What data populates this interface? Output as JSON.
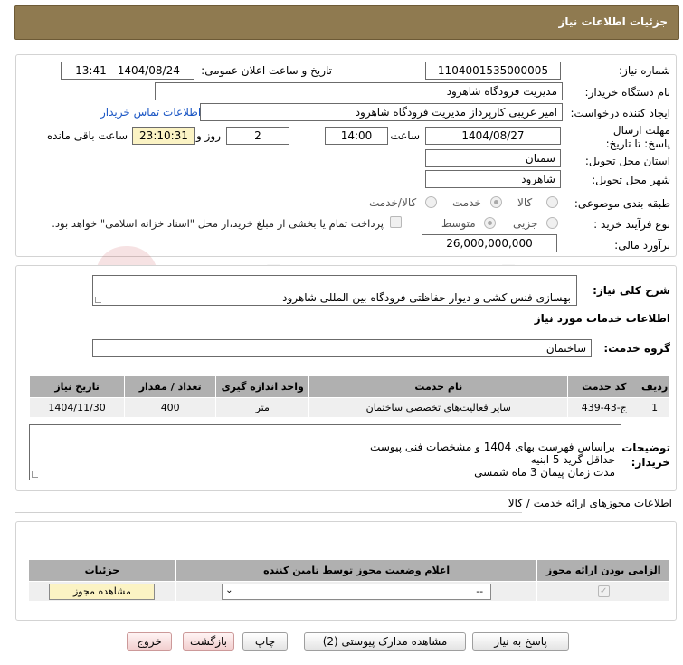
{
  "header": {
    "title": "جزئیات اطلاعات نیاز"
  },
  "form": {
    "need_number_label": "شماره نیاز:",
    "need_number": "1104001535000005",
    "announce_label": "تاریخ و ساعت اعلان عمومی:",
    "announce_value": "1404/08/24 - 13:41",
    "buyer_org_label": "نام دستگاه خریدار:",
    "buyer_org": "مدیریت فرودگاه شاهرود",
    "requester_label": "ایجاد کننده درخواست:",
    "requester": "امیر غریبی کارپرداز مدیریت فرودگاه شاهرود",
    "contact_link": "اطلاعات تماس خریدار",
    "deadline_label": "مهلت ارسال پاسخ: تا تاریخ:",
    "deadline_date": "1404/08/27",
    "time_label": "ساعت",
    "deadline_time": "14:00",
    "days_value": "2",
    "days_label": "روز و",
    "remaining_time": "23:10:31",
    "remaining_label": "ساعت باقی مانده",
    "province_label": "استان محل تحویل:",
    "province": "سمنان",
    "city_label": "شهر محل تحویل:",
    "city": "شاهرود",
    "category_label": "طبقه بندی موضوعی:",
    "category_options": [
      "کالا",
      "خدمت",
      "کالا/خدمت"
    ],
    "category_selected": "خدمت",
    "process_label": "نوع فرآیند خرید :",
    "process_options": [
      "جزیی",
      "متوسط"
    ],
    "process_selected": "متوسط",
    "payment_note": "پرداخت تمام یا بخشی از مبلغ خرید،از محل \"اسناد خزانه اسلامی\" خواهد بود.",
    "budget_label": "برآورد مالی:",
    "budget": "26,000,000,000"
  },
  "description": {
    "label": "شرح کلی نیاز:",
    "text": "بهسازی فنس کشی و دیوار حفاظتی فرودگاه بین المللی شاهرود"
  },
  "services": {
    "title": "اطلاعات خدمات مورد نیاز",
    "group_label": "گروه خدمت:",
    "group_value": "ساختمان",
    "columns": [
      "ردیف",
      "کد خدمت",
      "نام خدمت",
      "واحد اندازه گیری",
      "تعداد / مقدار",
      "تاریخ نیاز"
    ],
    "rows": [
      [
        "1",
        "ج-43-439",
        "سایر فعالیت‌های تخصصی ساختمان",
        "متر",
        "400",
        "1404/11/30"
      ]
    ]
  },
  "buyer_notes": {
    "label": "توضیحات خریدار:",
    "text": "براساس فهرست بهای 1404 و مشخصات فنی پیوست\nحداقل گرید 5 ابنیه\nمدت زمان پیمان 3 ماه شمسی"
  },
  "permits": {
    "title": "اطلاعات مجوزهای ارائه خدمت / کالا",
    "columns": [
      "الزامی بودن ارائه مجوز",
      "اعلام وضعیت مجوز توسط تامین کننده",
      "جزئیات"
    ],
    "select_value": "--",
    "view_button": "مشاهده مجوز"
  },
  "buttons": {
    "reply": "پاسخ به نیاز",
    "attachments": "مشاهده مدارک پیوستی (2)",
    "print": "چاپ",
    "back": "بازگشت",
    "exit": "خروج"
  },
  "colors": {
    "header": "#8f7a50",
    "highlight": "#fbf3c4",
    "table_header": "#b0b0b0"
  }
}
